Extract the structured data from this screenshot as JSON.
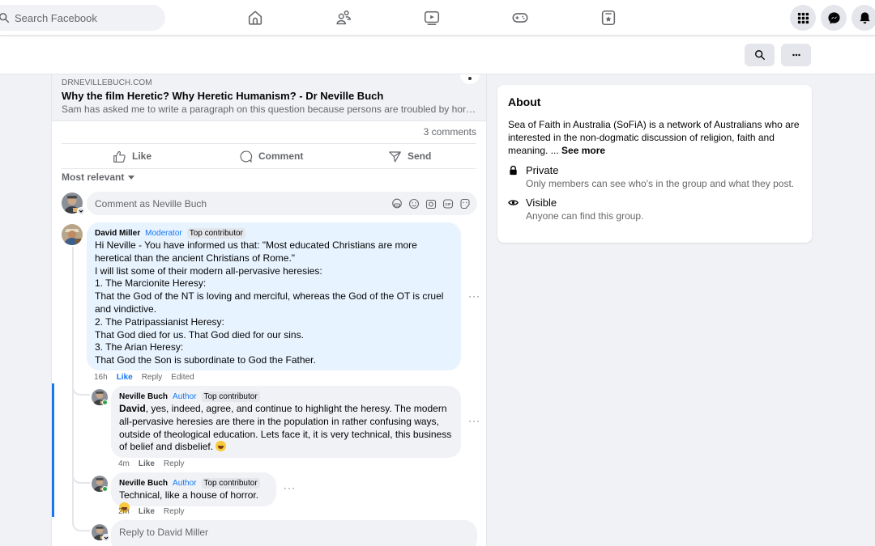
{
  "topbar": {
    "search_placeholder": "Search Facebook",
    "nav_icons": [
      "home-icon",
      "friends-icon",
      "video-icon",
      "gaming-icon",
      "feeds-icon"
    ],
    "right_buttons": [
      "menu-grid-icon",
      "messenger-icon",
      "notifications-bell-icon"
    ]
  },
  "subheader": {
    "buttons": [
      "search-icon",
      "more-options-icon"
    ],
    "more_label": "···"
  },
  "post": {
    "link_preview": {
      "domain": "DRNEVILLEBUCH.COM",
      "title": "Why the film Heretic? Why Heretic Humanism? - Dr Neville Buch",
      "description": "Sam has asked me to write a paragraph on this question because persons are troubled by horr..."
    },
    "comment_count": "3 comments",
    "actions": {
      "like": "Like",
      "comment": "Comment",
      "send": "Send"
    },
    "sort_label": "Most relevant",
    "comment_input_placeholder": "Comment as Neville Buch",
    "comment_input_icons": [
      "avatar-sticker-icon",
      "emoji-icon",
      "camera-icon",
      "gif-icon",
      "sticker-icon"
    ],
    "comments": [
      {
        "author": "David Miller",
        "role": "Moderator",
        "badge": "Top contributor",
        "lines": [
          "Hi Neville - You have informed us that: \"Most educated Christians are more heretical than the ancient Christians of Rome.\"",
          "I will list some of their modern all-pervasive heresies:",
          "1. The Marcionite Heresy:",
          "That the God of the NT is loving and merciful, whereas the God of the OT is cruel and vindictive.",
          "2. The Patripassianist Heresy:",
          "That God died for us. That God died for our sins.",
          "3. The Arian Heresy:",
          "That God the Son is subordinate to God the Father."
        ],
        "time": "16h",
        "like": "Like",
        "like_active": true,
        "reply": "Reply",
        "edited": "Edited",
        "more": "···"
      }
    ],
    "replies": [
      {
        "author": "Neville Buch",
        "role": "Author",
        "badge": "Top contributor",
        "mention": "David",
        "text": ", yes, indeed, agree, and continue to highlight the heresy. The modern all-pervasive heresies are there in the population in rather confusing ways, outside of theological education. Lets face it, it is very technical, this business of belief and disbelief.",
        "emoji": "grinning-face-emoji",
        "time": "4m",
        "like": "Like",
        "reply": "Reply",
        "more": "···"
      },
      {
        "author": "Neville Buch",
        "role": "Author",
        "badge": "Top contributor",
        "text": "Technical, like a house of horror.",
        "emoji": "laughing-face-emoji",
        "time": "2m",
        "like": "Like",
        "reply": "Reply",
        "more": "···"
      }
    ],
    "reply_input_placeholder": "Reply to David Miller"
  },
  "about": {
    "title": "About",
    "description": "Sea of Faith in Australia (SoFiA) is a network of Australians who are interested in the non-dogmatic discussion of religion, faith and meaning. ...",
    "see_more": "See more",
    "items": [
      {
        "icon": "lock-icon",
        "title": "Private",
        "subtitle": "Only members can see who's in the group and what they post."
      },
      {
        "icon": "eye-icon",
        "title": "Visible",
        "subtitle": "Anyone can find this group."
      }
    ]
  },
  "colors": {
    "accent": "#1877f2",
    "page_bg": "#f0f2f5",
    "moderator_bubble": "#e7f3ff",
    "online": "#31a24c"
  }
}
